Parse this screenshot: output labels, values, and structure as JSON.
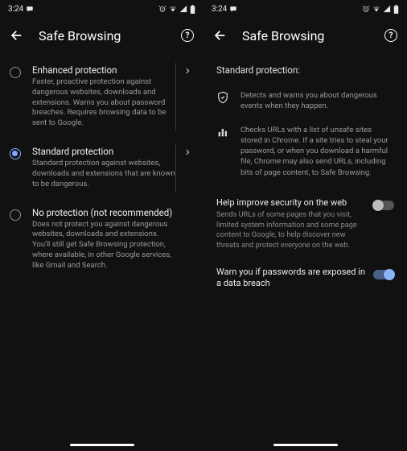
{
  "status": {
    "time": "3:24"
  },
  "left": {
    "title": "Safe Browsing",
    "options": {
      "enhanced": {
        "title": "Enhanced protection",
        "desc": "Faster, proactive protection against dangerous websites, downloads and extensions. Warns you about password breaches. Requires browsing data to be sent to Google."
      },
      "standard": {
        "title": "Standard protection",
        "desc": "Standard protection against websites, downloads and extensions that are known to be dangerous."
      },
      "none": {
        "title": "No protection (not recommended)",
        "desc": "Does not protect you against dangerous websites, downloads and extensions. You'll still get Safe Browsing protection, where available, in other Google services, like Gmail and Search."
      }
    }
  },
  "right": {
    "title": "Safe Browsing",
    "section": "Standard protection:",
    "bullet1": "Detects and warns you about dangerous events when they happen.",
    "bullet2": "Checks URLs with a list of unsafe sites stored in Chrome. If a site tries to steal your password, or when you download a harmful file, Chrome may also send URLs, including bits of page content, to Safe Browsing.",
    "setting1": {
      "title": "Help improve security on the web",
      "desc": "Sends URLs of some pages that you visit, limited system information and some page content to Google, to help discover new threats and protect everyone on the web."
    },
    "setting2": {
      "title": "Warn you if passwords are exposed in a data breach"
    }
  }
}
